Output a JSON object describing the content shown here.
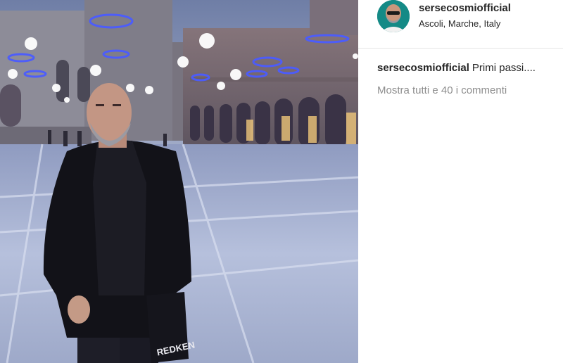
{
  "post": {
    "username": "sersecosmiofficial",
    "location": "Ascoli, Marche, Italy",
    "caption_user": "sersecosmiofficial",
    "caption_text": "Primi passi....",
    "view_comments": "Mostra tutti e 40 i commenti",
    "bag_text": "REDKEN"
  },
  "colors": {
    "sky": "#7a86a8",
    "pavement": "#b3bedb",
    "building": "#8e8a96",
    "accent_lights": "#3b4fe0"
  }
}
